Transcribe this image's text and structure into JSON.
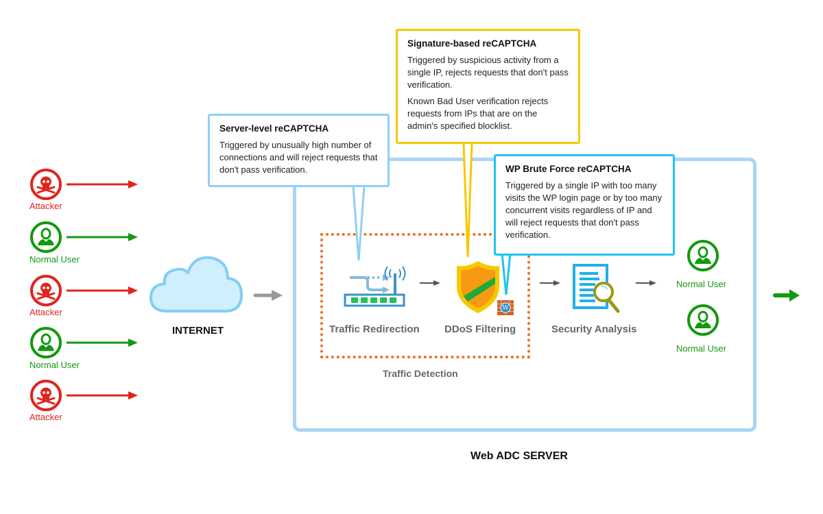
{
  "sources": [
    {
      "type": "attacker",
      "label": "Attacker",
      "icon": "skull-icon"
    },
    {
      "type": "normal",
      "label": "Normal User",
      "icon": "user-icon"
    },
    {
      "type": "attacker",
      "label": "Attacker",
      "icon": "skull-icon"
    },
    {
      "type": "normal",
      "label": "Normal User",
      "icon": "user-icon"
    },
    {
      "type": "attacker",
      "label": "Attacker",
      "icon": "skull-icon"
    }
  ],
  "internet": {
    "label": "INTERNET",
    "icon": "cloud-icon"
  },
  "server": {
    "label": "Web ADC SERVER"
  },
  "detection": {
    "label": "Traffic Detection"
  },
  "stages": [
    {
      "label": "Traffic Redirection",
      "icon": "router-icon"
    },
    {
      "label": "DDoS Filtering",
      "icon": "shield-icon"
    },
    {
      "label": "Security Analysis",
      "icon": "document-search-icon"
    }
  ],
  "outputs": [
    {
      "label": "Normal User",
      "icon": "user-icon"
    },
    {
      "label": "Normal User",
      "icon": "user-icon"
    }
  ],
  "callouts": {
    "server_level": {
      "title": "Server-level reCAPTCHA",
      "body": "Triggered by unusually high number of connections and will reject requests that don't pass verification."
    },
    "signature": {
      "title": "Signature-based reCAPTCHA",
      "body": "Triggered by suspicious activity from a single IP, rejects requests that don't pass verification.",
      "body2": "Known Bad User verification rejects requests from IPs that are on the admin's specified blocklist."
    },
    "wp_brute": {
      "title": "WP Brute Force reCAPTCHA",
      "body": "Triggered by a single IP with too many visits the WP login page or by too many concurrent visits regardless of IP and will reject requests that don't pass verification."
    }
  },
  "colors": {
    "attacker": "#e1231c",
    "normal": "#12990f",
    "server_border": "#a9d4f5",
    "detection_border": "#f26b1d",
    "callout_blue": "#8fd0f5",
    "callout_yellow": "#f7c800",
    "callout_cyan": "#1fc3f0"
  }
}
